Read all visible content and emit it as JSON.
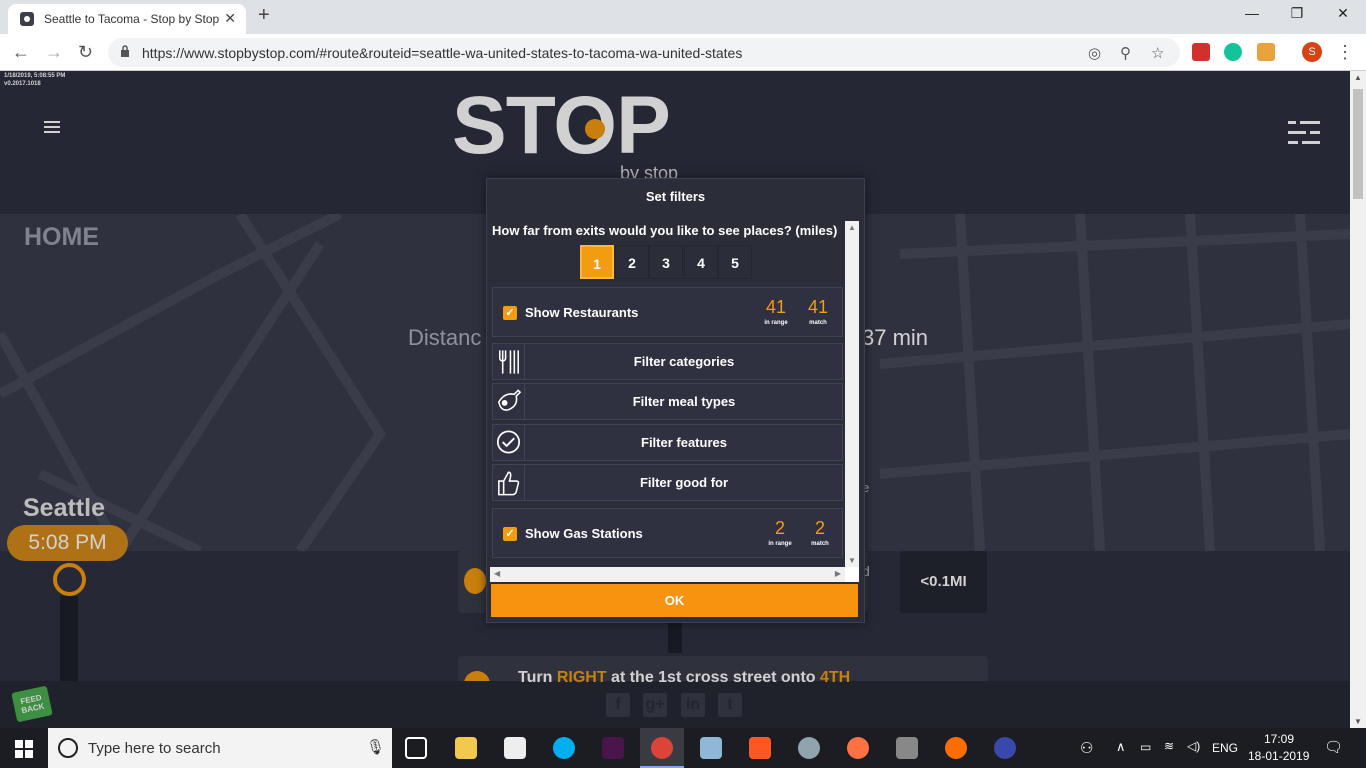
{
  "browser": {
    "tab_title": "Seattle to Tacoma - Stop by Stop",
    "tab_close": "✕",
    "new_tab": "+",
    "url": "https://www.stopbystop.com/#route&routeid=seattle-wa-united-states-to-tacoma-wa-united-states",
    "profile_initial": "S",
    "window_controls": {
      "minimize": "—",
      "restore": "❐",
      "close": "✕"
    }
  },
  "page": {
    "debug_date": "1/18/2019, 5:08:55 PM",
    "debug_version": "v0.2017.1018",
    "logo_main": "STOP",
    "logo_sub": "by stop",
    "nav_home": "HOME",
    "distance_label": "Distanc",
    "duration_label": "37 min",
    "partial_right_e": "e",
    "partial_right_d": "d",
    "city": "Seattle",
    "time": "5:08 PM",
    "step_distance": "<0.1MI",
    "turn_pre": "Turn ",
    "turn_hl1": "RIGHT",
    "turn_mid": " at the 1st cross street onto ",
    "turn_hl2": "4TH",
    "feedback": "FEED BACK",
    "social": [
      "f",
      "g+",
      "in",
      "t"
    ]
  },
  "modal": {
    "title": "Set filters",
    "question": "How far from exits would you like to see places? (miles)",
    "miles": [
      "1",
      "2",
      "3",
      "4",
      "5"
    ],
    "selected_mile": "1",
    "restaurants": {
      "label": "Show Restaurants",
      "in_range": "41",
      "match": "41",
      "checked": true
    },
    "filters": [
      {
        "label": "Filter categories",
        "icon": "utensils-icon"
      },
      {
        "label": "Filter meal types",
        "icon": "meal-icon"
      },
      {
        "label": "Filter features",
        "icon": "check-circle-icon"
      },
      {
        "label": "Filter good for",
        "icon": "thumbs-up-icon"
      }
    ],
    "gas": {
      "label": "Show Gas Stations",
      "in_range": "2",
      "match": "2",
      "checked": true
    },
    "in_range_label": "in range",
    "match_label": "match",
    "ok": "OK"
  },
  "taskbar": {
    "search_placeholder": "Type here to search",
    "lang": "ENG",
    "clock_time": "17:09",
    "clock_date": "18-01-2019"
  },
  "colors": {
    "accent": "#f49c0f",
    "page_bg": "#2b2e3b",
    "modal_bg": "#2b2d38"
  }
}
